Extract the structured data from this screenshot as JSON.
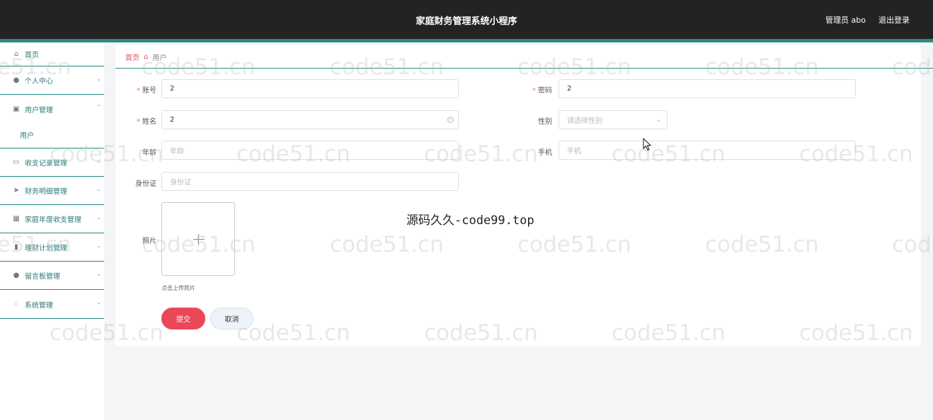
{
  "header": {
    "title": "家庭财务管理系统小程序",
    "admin": "管理员 abo",
    "logout": "退出登录"
  },
  "sidebar": {
    "items": [
      {
        "label": "首页",
        "icon": "home-icon"
      },
      {
        "label": "个人中心",
        "icon": "user-icon"
      },
      {
        "label": "用户管理",
        "icon": "clipboard-icon"
      },
      {
        "label": "收支记录管理",
        "icon": "chat-icon"
      },
      {
        "label": "财务明细管理",
        "icon": "send-icon"
      },
      {
        "label": "家庭年度收支管理",
        "icon": "grid-icon"
      },
      {
        "label": "理财计划管理",
        "icon": "bar-chart-icon"
      },
      {
        "label": "留言板管理",
        "icon": "bulb-icon"
      },
      {
        "label": "系统管理",
        "icon": "bell-icon"
      }
    ],
    "sub_item": "用户"
  },
  "breadcrumb": {
    "home": "首页",
    "current": "用户"
  },
  "form": {
    "account_label": "账号",
    "account_value": "2",
    "password_label": "密码",
    "password_value": "2",
    "name_label": "姓名",
    "name_value": "2",
    "gender_label": "性别",
    "gender_placeholder": "请选择性别",
    "age_label": "年龄",
    "age_placeholder": "年龄",
    "phone_label": "手机",
    "phone_placeholder": "手机",
    "id_label": "身份证",
    "id_placeholder": "身份证",
    "photo_label": "照片",
    "upload_tip": "点击上传照片",
    "submit": "提交",
    "cancel": "取消"
  },
  "overlay_text": "源码久久-code99.top",
  "watermark": "code51.cn"
}
